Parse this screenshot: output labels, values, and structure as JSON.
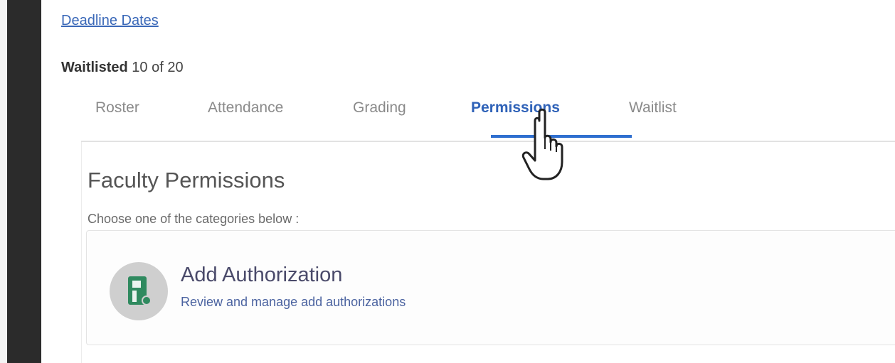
{
  "links": {
    "deadline_dates": "Deadline Dates"
  },
  "waitlist": {
    "label": "Waitlisted",
    "value": "10 of 20"
  },
  "tabs": [
    {
      "label": "Roster"
    },
    {
      "label": "Attendance"
    },
    {
      "label": "Grading"
    },
    {
      "label": "Permissions",
      "active": true
    },
    {
      "label": "Waitlist"
    }
  ],
  "permissions": {
    "title": "Faculty Permissions",
    "subtitle": "Choose one of the categories below :",
    "cards": [
      {
        "title": "Add Authorization",
        "description": "Review and manage add authorizations",
        "icon": "document-icon"
      }
    ]
  },
  "colors": {
    "accent": "#2f6fcf",
    "link": "#3a68b8",
    "sidebar": "#2b2b2b"
  }
}
